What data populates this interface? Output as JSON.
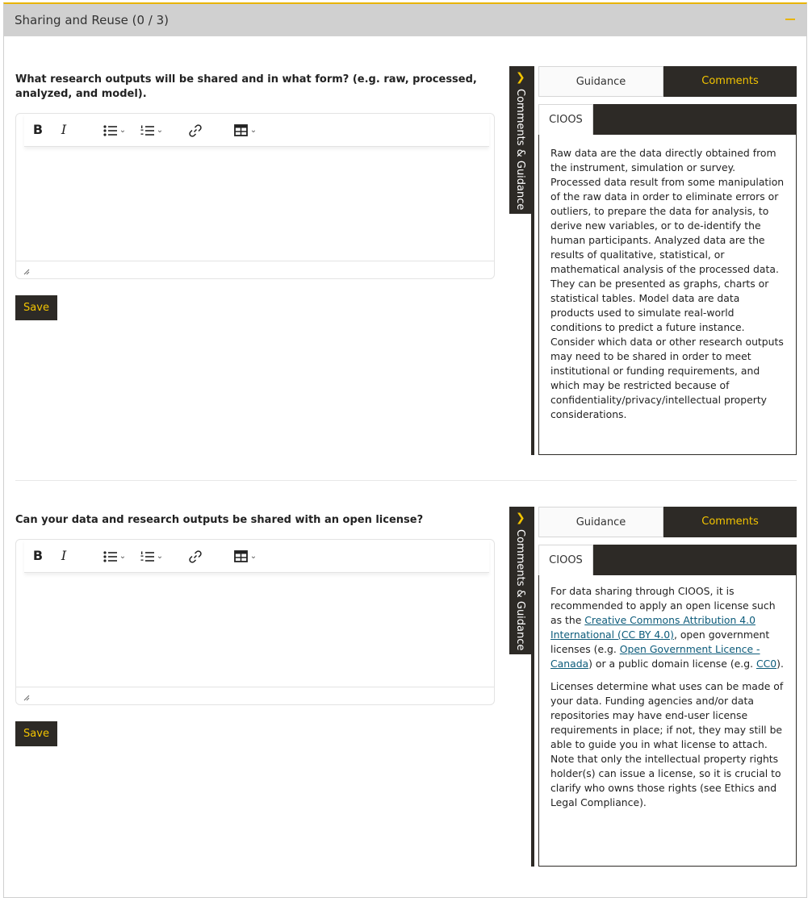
{
  "section": {
    "title": "Sharing and Reuse (0 / 3)"
  },
  "toolbar": {
    "bold": "B",
    "italic": "I",
    "bullet_list_icon": "bullet-list-icon",
    "numbered_list_icon": "numbered-list-icon",
    "link_icon": "link-icon",
    "table_icon": "table-icon"
  },
  "side_panel": {
    "toggle_label": "Comments & Guidance",
    "tab_guidance": "Guidance",
    "tab_comments": "Comments",
    "org_tab": "CIOOS"
  },
  "questions": [
    {
      "text": "What research outputs will be shared and in what form? (e.g. raw, processed, analyzed, and model).",
      "save_label": "Save",
      "guidance": "Raw data are the data directly obtained from the instrument, simulation or survey. Processed data result from some manipulation of the raw data in order to eliminate errors or outliers, to prepare the data for analysis, to derive new variables, or to de-identify the human participants. Analyzed data are the results of qualitative, statistical, or mathematical analysis of the processed data. They can be presented as graphs, charts or statistical tables. Model data are data products used to simulate real-world conditions to predict a future instance. Consider which data or other research outputs may need to be shared in order to meet institutional or funding requirements, and which may be restricted because of confidentiality/privacy/intellectual property considerations."
    },
    {
      "text": "Can your data and research outputs be shared with an open license?",
      "save_label": "Save",
      "guidance_p1_a": "For data sharing through CIOOS, it is recommended to apply an open license such as the ",
      "guidance_link1": "Creative Commons Attribution 4.0 International (CC BY 4.0)",
      "guidance_p1_b": ", open government licenses (e.g. ",
      "guidance_link2": "Open Government Licence - Canada",
      "guidance_p1_c": ") or a public domain license (e.g. ",
      "guidance_link3": "CC0",
      "guidance_p1_d": ").",
      "guidance_p2": "Licenses determine what uses can be made of your data. Funding agencies and/or data repositories may have end-user license requirements in place; if not, they may still be able to guide you in what license to attach. Note that only the intellectual property rights holder(s) can issue a license, so it is crucial to clarify who owns those rights (see Ethics and Legal Compliance)."
    }
  ],
  "colors": {
    "accent": "#f3c400",
    "dark": "#2d2a26",
    "header_bg": "#d0d0d0",
    "link": "#0c5b7a"
  }
}
